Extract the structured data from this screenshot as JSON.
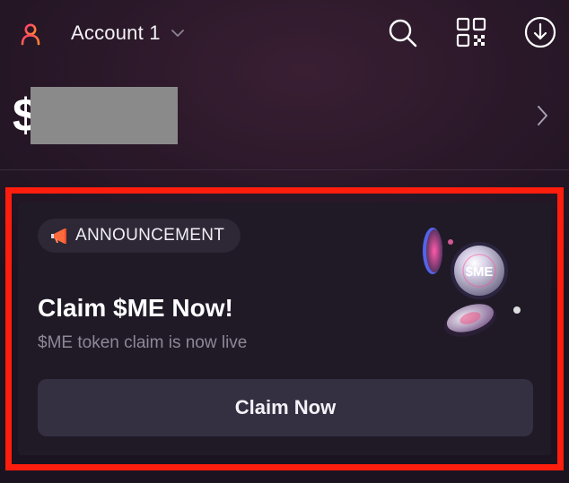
{
  "header": {
    "account_name": "Account 1",
    "avatar_icon": "user-icon",
    "account_chevron_icon": "chevron-down-icon",
    "search_icon": "search-icon",
    "qr_icon": "qr-code-icon",
    "download_icon": "download-circle-icon"
  },
  "balance": {
    "currency_symbol": "$",
    "value_redacted": true,
    "chevron_icon": "chevron-right-icon"
  },
  "announcement": {
    "badge_icon": "megaphone-icon",
    "badge_label": "ANNOUNCEMENT",
    "title": "Claim $ME Now!",
    "subtitle": "$ME token claim is now live",
    "coin_label": "$ME",
    "button_label": "Claim Now"
  },
  "colors": {
    "background": "#1c1320",
    "card": "#201a27",
    "badge": "#2d2736",
    "button": "#343042",
    "highlight": "#ff1d0d",
    "avatar_accent": "#ff5a3d",
    "subtitle": "#8d8797"
  }
}
